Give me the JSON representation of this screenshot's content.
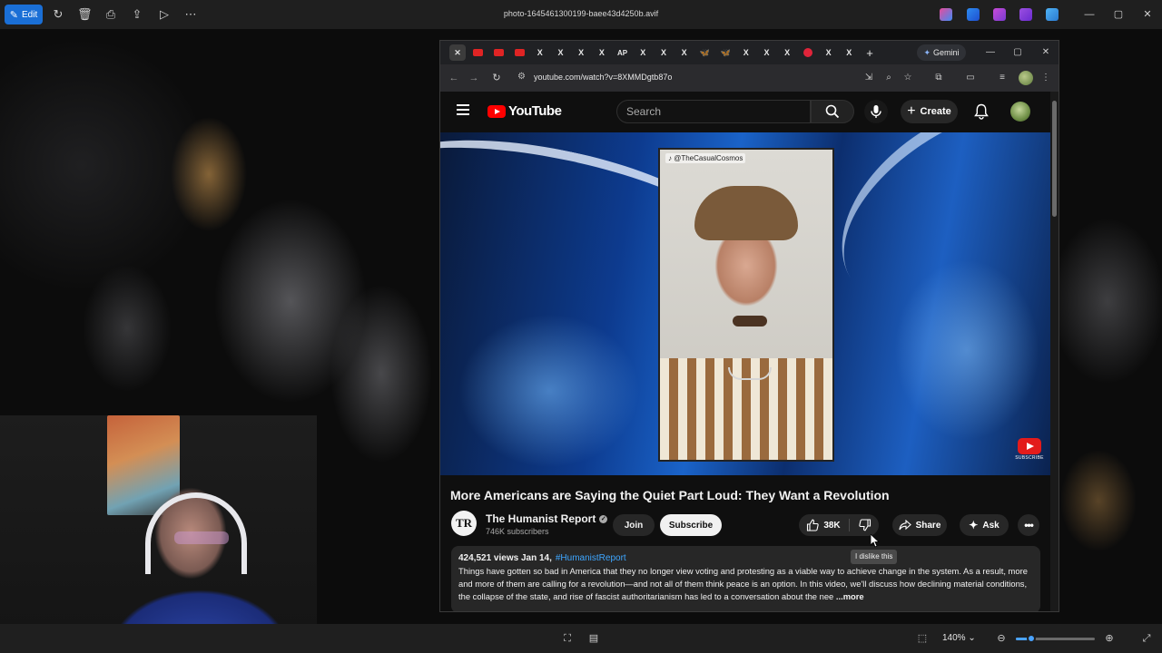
{
  "photos_app": {
    "edit_label": "Edit",
    "title": "photo-1645461300199-baee43d4250b.avif",
    "zoom_label": "140%",
    "zoom_fraction": 0.2
  },
  "browser": {
    "url": "youtube.com/watch?v=8XMMDgtb87o",
    "gemini_label": "Gemini",
    "tabs": [
      {
        "type": "active-close",
        "glyph": "✕"
      },
      {
        "type": "yt"
      },
      {
        "type": "yt"
      },
      {
        "type": "yt"
      },
      {
        "type": "x",
        "glyph": "X"
      },
      {
        "type": "x",
        "glyph": "X"
      },
      {
        "type": "x",
        "glyph": "X"
      },
      {
        "type": "x",
        "glyph": "X"
      },
      {
        "type": "ap",
        "glyph": "AP"
      },
      {
        "type": "x",
        "glyph": "X"
      },
      {
        "type": "x",
        "glyph": "X"
      },
      {
        "type": "x",
        "glyph": "X"
      },
      {
        "type": "bf",
        "glyph": "🦋"
      },
      {
        "type": "bf",
        "glyph": "🦋"
      },
      {
        "type": "x",
        "glyph": "X"
      },
      {
        "type": "x",
        "glyph": "X"
      },
      {
        "type": "x",
        "glyph": "X"
      },
      {
        "type": "red"
      },
      {
        "type": "x",
        "glyph": "X"
      },
      {
        "type": "x",
        "glyph": "X"
      },
      {
        "type": "new",
        "glyph": "+"
      }
    ]
  },
  "youtube": {
    "logo_text": "YouTube",
    "search_placeholder": "Search",
    "create_label": "Create",
    "player": {
      "overlay_handle": "♪ @TheCasualCosmos",
      "subscribe_badge": "SUBSCRIBE"
    },
    "video": {
      "title": "More Americans are Saying the Quiet Part Loud: They Want a Revolution",
      "channel_name": "The Humanist Report",
      "channel_initials": "TR",
      "verified_glyph": "✓",
      "subscribers": "746K subscribers",
      "join_label": "Join",
      "subscribe_label": "Subscribe",
      "likes": "38K",
      "share_label": "Share",
      "ask_label": "Ask",
      "more_glyph": "•••",
      "dislike_tooltip": "I dislike this",
      "description": {
        "views_date": "424,521 views  Jan 14,",
        "hashtag": "#HumanistReport",
        "text": "Things have gotten so bad in America that they no longer view voting and protesting as a viable way to achieve change in the system. As a result, more and more of them are calling for a revolution—and not all of them think peace is an option. In this video, we'll discuss how declining material conditions, the collapse of the state, and rise of fascist authoritarianism has led to a conversation about the nee",
        "more_label": "...more"
      }
    }
  },
  "colors": {
    "accent_blue": "#1a6fd6",
    "youtube_red": "#ff0000",
    "link_blue": "#3ea6ff"
  }
}
